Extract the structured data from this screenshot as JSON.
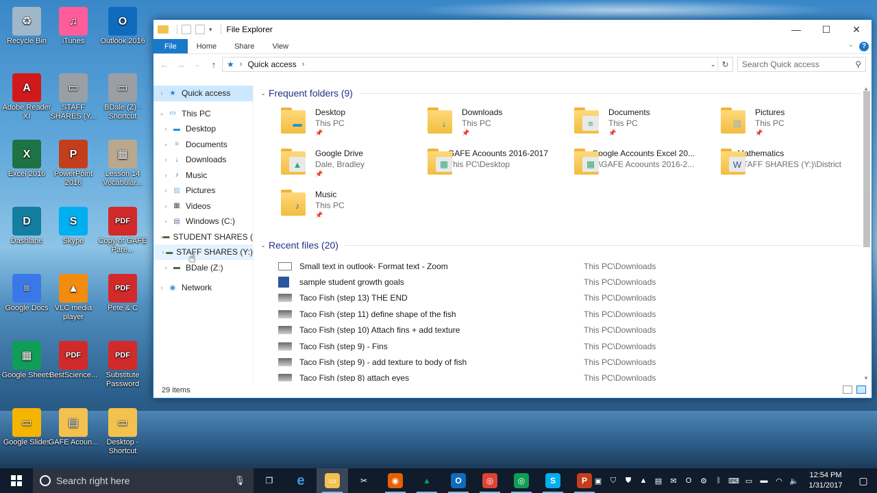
{
  "desktop": {
    "icons": [
      {
        "label": "Recycle Bin",
        "icon": "recycle-bin-icon",
        "color": "#9fb7c9",
        "glyph": "♻"
      },
      {
        "label": "iTunes",
        "icon": "itunes-icon",
        "color": "#ff5c9c",
        "glyph": "♫"
      },
      {
        "label": "Outlook 2016",
        "icon": "outlook-icon",
        "color": "#0f6cbd",
        "glyph": "O"
      },
      {
        "label": "Adobe Reader XI",
        "icon": "adobe-reader-icon",
        "color": "#d0191b",
        "glyph": "A"
      },
      {
        "label": "STAFF SHARES (Y...",
        "icon": "network-drive-icon",
        "color": "#9a9fa5",
        "glyph": "▭"
      },
      {
        "label": "BDale (Z) - Shortcut",
        "icon": "network-drive-icon",
        "color": "#9a9fa5",
        "glyph": "▭"
      },
      {
        "label": "Excel 2016",
        "icon": "excel-icon",
        "color": "#1f7244",
        "glyph": "X"
      },
      {
        "label": "PowerPoint 2016",
        "icon": "powerpoint-icon",
        "color": "#c43e1c",
        "glyph": "P"
      },
      {
        "label": "Lesson 14 Vocabular...",
        "icon": "presentation-file-icon",
        "color": "#b9a88d",
        "glyph": "▦"
      },
      {
        "label": "Dashlane",
        "icon": "dashlane-icon",
        "color": "#137ea0",
        "glyph": "D"
      },
      {
        "label": "Skype",
        "icon": "skype-icon",
        "color": "#00aff0",
        "glyph": "S"
      },
      {
        "label": "Copy of GAFE Pare...",
        "icon": "pdf-file-icon",
        "color": "#d22a2a",
        "glyph": "PDF"
      },
      {
        "label": "Google Docs",
        "icon": "google-docs-icon",
        "color": "#3b78e7",
        "glyph": "≡"
      },
      {
        "label": "VLC media player",
        "icon": "vlc-icon",
        "color": "#f28c0e",
        "glyph": "▲"
      },
      {
        "label": "Pete & C",
        "icon": "pdf-file-icon",
        "color": "#d22a2a",
        "glyph": "PDF"
      },
      {
        "label": "Google Sheets",
        "icon": "google-sheets-icon",
        "color": "#0f9d58",
        "glyph": "▦"
      },
      {
        "label": "BestScience...",
        "icon": "pdf-file-icon",
        "color": "#d22a2a",
        "glyph": "PDF"
      },
      {
        "label": "Substitute Password",
        "icon": "pdf-file-icon",
        "color": "#d22a2a",
        "glyph": "PDF"
      },
      {
        "label": "Google Slides",
        "icon": "google-slides-icon",
        "color": "#f4b400",
        "glyph": "▭"
      },
      {
        "label": "GAFE Acoun...",
        "icon": "folder-icon",
        "color": "#f2c14e",
        "glyph": "▤"
      },
      {
        "label": "Desktop - Shortcut",
        "icon": "folder-icon",
        "color": "#f2c14e",
        "glyph": "▭"
      }
    ]
  },
  "window": {
    "title": "File Explorer",
    "ribbon_tabs": [
      "File",
      "Home",
      "Share",
      "View"
    ],
    "address": "Quick access",
    "search_placeholder": "Search Quick access",
    "status_text": "29 items"
  },
  "nav": {
    "items": [
      {
        "label": "Quick access",
        "icon": "star-icon",
        "level": 0
      },
      {
        "label": "This PC",
        "icon": "computer-icon",
        "level": 0
      },
      {
        "label": "Desktop",
        "icon": "desktop-folder-icon",
        "level": 1
      },
      {
        "label": "Documents",
        "icon": "documents-icon",
        "level": 1
      },
      {
        "label": "Downloads",
        "icon": "downloads-icon",
        "level": 1
      },
      {
        "label": "Music",
        "icon": "music-icon",
        "level": 1
      },
      {
        "label": "Pictures",
        "icon": "pictures-icon",
        "level": 1
      },
      {
        "label": "Videos",
        "icon": "videos-icon",
        "level": 1
      },
      {
        "label": "Windows (C:)",
        "icon": "drive-icon",
        "level": 1
      },
      {
        "label": "STUDENT SHARES (",
        "icon": "network-drive-icon",
        "level": 1
      },
      {
        "label": "STAFF SHARES (Y:)",
        "icon": "network-drive-icon",
        "level": 1
      },
      {
        "label": "BDale (Z:)",
        "icon": "network-drive-icon",
        "level": 1
      },
      {
        "label": "Network",
        "icon": "network-icon",
        "level": 0
      }
    ]
  },
  "frequent": {
    "header": "Frequent folders (9)",
    "folders": [
      {
        "name": "Desktop",
        "location": "This PC",
        "pinned": true,
        "overlay": "desktop-overlay-icon",
        "overlay_color": "#1e90d8",
        "glyph": "▬"
      },
      {
        "name": "Downloads",
        "location": "This PC",
        "pinned": true,
        "overlay": "download-arrow-icon",
        "overlay_color": "#1979ca",
        "glyph": "↓"
      },
      {
        "name": "Documents",
        "location": "This PC",
        "pinned": true,
        "overlay": "document-overlay-icon",
        "overlay_color": "#ffffff",
        "glyph": "≡"
      },
      {
        "name": "Pictures",
        "location": "This PC",
        "pinned": true,
        "overlay": "picture-overlay-icon",
        "overlay_color": "#7fb6de",
        "glyph": "▨"
      },
      {
        "name": "Google Drive",
        "location": "Dale, Bradley",
        "pinned": true,
        "overlay": "google-drive-icon",
        "overlay_color": "#ffffff",
        "glyph": "▲"
      },
      {
        "name": "GAFE Acoounts 2016-2017",
        "location": "This PC\\Desktop",
        "pinned": false,
        "overlay": "spreadsheet-overlay-icon",
        "overlay_color": "#ffffff",
        "glyph": "▦"
      },
      {
        "name": "Google Accounts Excel 20...",
        "location": "...\\GAFE Acoounts 2016-2...",
        "pinned": false,
        "overlay": "spreadsheet-overlay-icon",
        "overlay_color": "#ffffff",
        "glyph": "▦"
      },
      {
        "name": "Mathematics",
        "location": "STAFF SHARES (Y:)\\District",
        "pinned": false,
        "overlay": "word-doc-overlay-icon",
        "overlay_color": "#ffffff",
        "glyph": "W"
      },
      {
        "name": "Music",
        "location": "This PC",
        "pinned": true,
        "overlay": "music-note-icon",
        "overlay_color": "#1979ca",
        "glyph": "♪"
      }
    ]
  },
  "recent": {
    "header": "Recent files (20)",
    "files": [
      {
        "name": "Small text in outlook- Format text - Zoom",
        "path": "This PC\\Downloads",
        "icon": "blank-image-icon"
      },
      {
        "name": "sample student growth goals",
        "path": "This PC\\Downloads",
        "icon": "word-file-icon"
      },
      {
        "name": "Taco Fish (step 13) THE END",
        "path": "This PC\\Downloads",
        "icon": "image-thumbnail-icon"
      },
      {
        "name": "Taco Fish (step 11) define shape of the fish",
        "path": "This PC\\Downloads",
        "icon": "image-thumbnail-icon"
      },
      {
        "name": "Taco Fish (step 10) Attach fins + add texture",
        "path": "This PC\\Downloads",
        "icon": "image-thumbnail-icon"
      },
      {
        "name": "Taco Fish (step 9) - Fins",
        "path": "This PC\\Downloads",
        "icon": "image-thumbnail-icon"
      },
      {
        "name": "Taco Fish (step 9) - add texture to body of fish",
        "path": "This PC\\Downloads",
        "icon": "image-thumbnail-icon"
      },
      {
        "name": "Taco Fish (step 8) attach eyes",
        "path": "This PC\\Downloads",
        "icon": "image-thumbnail-icon"
      }
    ]
  },
  "taskbar": {
    "search_placeholder": "Search right here",
    "apps": [
      {
        "icon": "task-view-icon",
        "color": "transparent",
        "glyph": "❐"
      },
      {
        "icon": "edge-icon",
        "color": "transparent",
        "glyph": "e"
      },
      {
        "icon": "file-explorer-icon",
        "color": "#f2c14e",
        "glyph": "▭"
      },
      {
        "icon": "snipping-tool-icon",
        "color": "transparent",
        "glyph": "✂"
      },
      {
        "icon": "firefox-icon",
        "color": "#e66000",
        "glyph": "◉"
      },
      {
        "icon": "google-drive-icon",
        "color": "transparent",
        "glyph": "▲"
      },
      {
        "icon": "outlook-icon",
        "color": "#0f6cbd",
        "glyph": "O"
      },
      {
        "icon": "chrome-icon",
        "color": "#db4437",
        "glyph": "◎"
      },
      {
        "icon": "chrome-icon",
        "color": "#0f9d58",
        "glyph": "◎"
      },
      {
        "icon": "skype-icon",
        "color": "#00aff0",
        "glyph": "S"
      },
      {
        "icon": "powerpoint-icon",
        "color": "#c43e1c",
        "glyph": "P"
      }
    ],
    "time": "12:54 PM",
    "date": "1/31/2017"
  }
}
